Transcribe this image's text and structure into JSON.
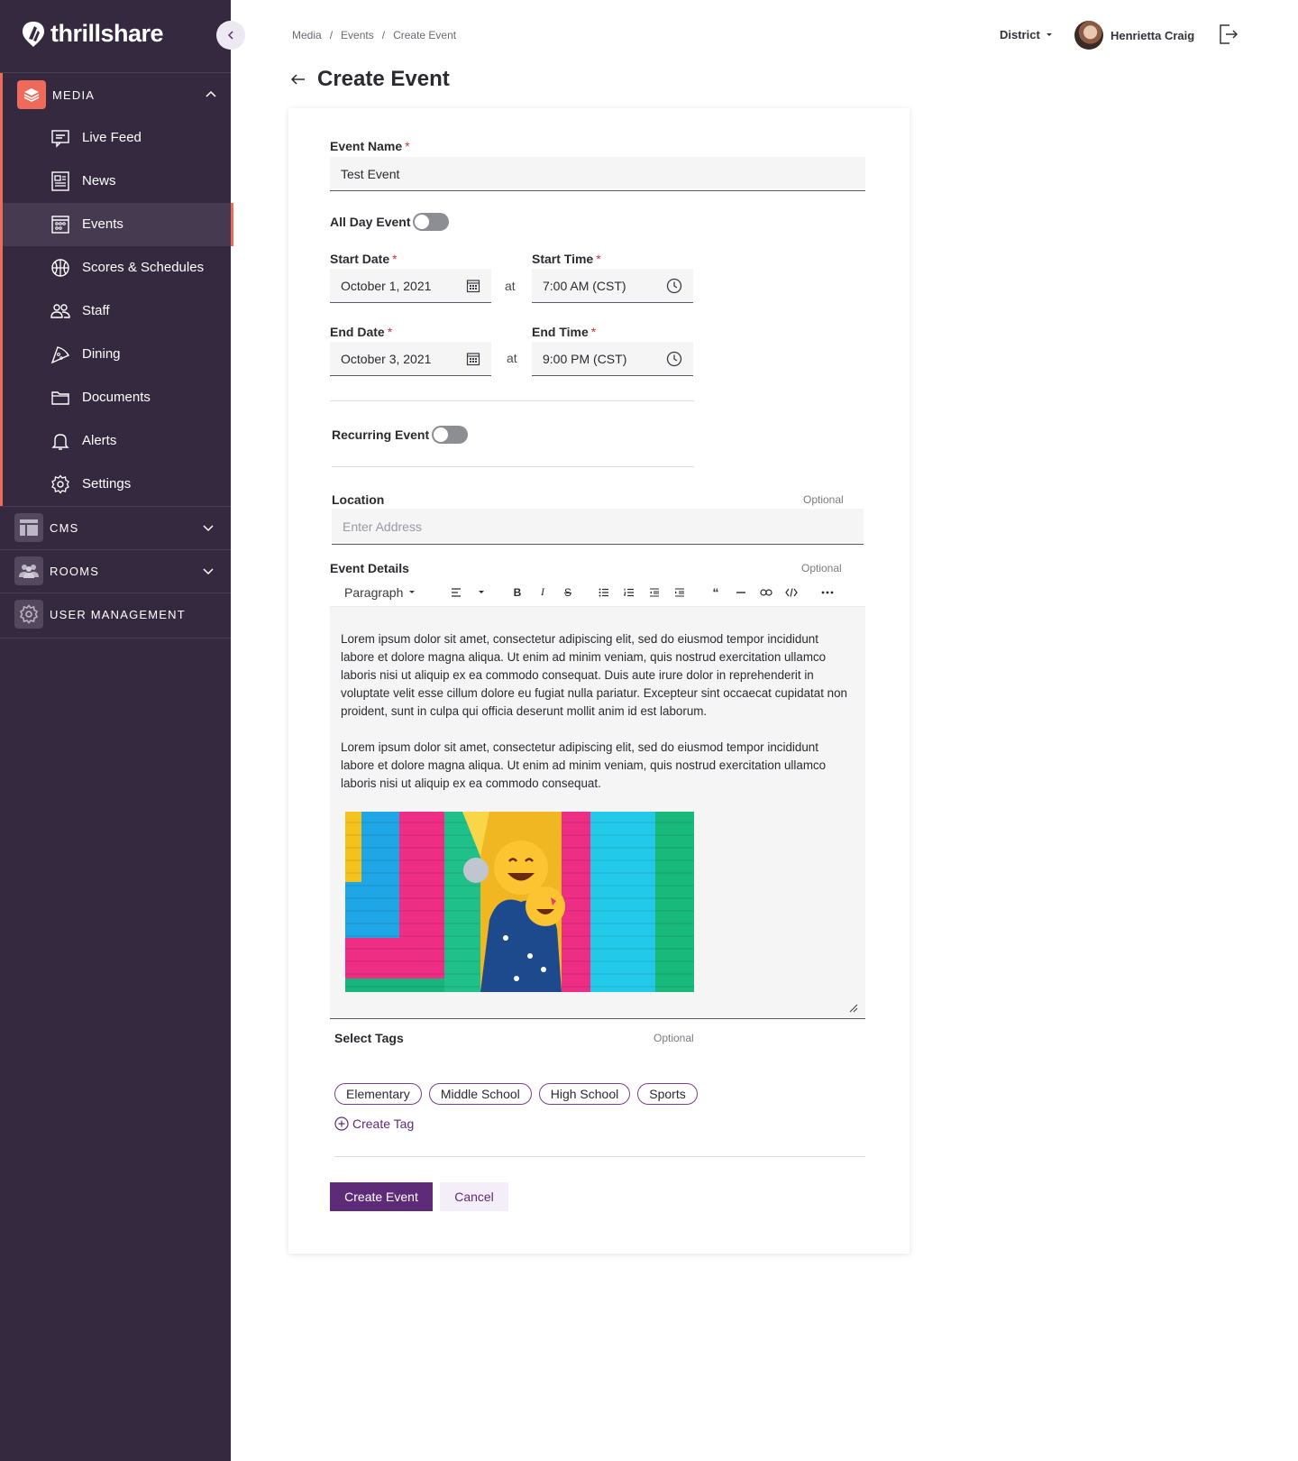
{
  "brand": {
    "name": "thrillshare"
  },
  "sidebar": {
    "sections": [
      {
        "label": "MEDIA",
        "icon": "layers-icon",
        "expanded": true,
        "color": "#f06a5a"
      },
      {
        "label": "CMS",
        "icon": "layout-icon",
        "expanded": false
      },
      {
        "label": "ROOMS",
        "icon": "group-icon",
        "expanded": false
      },
      {
        "label": "USER MANAGEMENT",
        "icon": "gear-icon",
        "expanded": false
      }
    ],
    "media_items": [
      {
        "label": "Live Feed",
        "icon": "chat-icon"
      },
      {
        "label": "News",
        "icon": "newspaper-icon"
      },
      {
        "label": "Events",
        "icon": "calendar-icon",
        "active": true
      },
      {
        "label": "Scores & Schedules",
        "icon": "ball-icon"
      },
      {
        "label": "Staff",
        "icon": "people-icon"
      },
      {
        "label": "Dining",
        "icon": "pizza-icon"
      },
      {
        "label": "Documents",
        "icon": "folder-icon"
      },
      {
        "label": "Alerts",
        "icon": "bell-icon"
      },
      {
        "label": "Settings",
        "icon": "gear-icon"
      }
    ]
  },
  "breadcrumb": [
    "Media",
    "Events",
    "Create Event"
  ],
  "topbar": {
    "district": "District",
    "user_name": "Henrietta Craig"
  },
  "page": {
    "title": "Create Event"
  },
  "form": {
    "event_name": {
      "label": "Event Name",
      "value": "Test Event"
    },
    "all_day": {
      "label": "All Day Event",
      "on": false
    },
    "start_date": {
      "label": "Start Date",
      "value": "October 1, 2021"
    },
    "start_time": {
      "label": "Start Time",
      "value": "7:00 AM (CST)"
    },
    "end_date": {
      "label": "End Date",
      "value": "October 3, 2021"
    },
    "end_time": {
      "label": "End Time",
      "value": "9:00 PM (CST)"
    },
    "at_label": "at",
    "recurring": {
      "label": "Recurring Event",
      "on": false
    },
    "location": {
      "label": "Location",
      "placeholder": "Enter Address",
      "optional": "Optional"
    },
    "details": {
      "label": "Event Details",
      "optional": "Optional",
      "block_style": "Paragraph",
      "paragraphs": [
        "Lorem ipsum dolor sit amet, consectetur adipiscing elit, sed do eiusmod tempor incididunt labore et dolore magna aliqua. Ut enim ad minim veniam, quis nostrud exercitation ullamco laboris nisi ut aliquip ex ea commodo consequat. Duis aute irure dolor in reprehenderit in voluptate velit esse cillum dolore eu fugiat nulla pariatur. Excepteur sint occaecat cupidatat non proident, sunt in culpa qui officia deserunt mollit anim id est laborum.",
        "Lorem ipsum dolor sit amet, consectetur adipiscing elit, sed do eiusmod tempor incididunt labore et dolore magna aliqua. Ut enim ad minim veniam, quis nostrud exercitation ullamco laboris nisi ut aliquip ex ea commodo consequat."
      ]
    },
    "tags": {
      "label": "Select Tags",
      "optional": "Optional",
      "items": [
        "Elementary",
        "Middle School",
        "High School",
        "Sports"
      ],
      "create_label": "Create Tag"
    },
    "submit_label": "Create Event",
    "cancel_label": "Cancel"
  },
  "colors": {
    "sidebar": "#35293f",
    "accent": "#f06a5a",
    "primary": "#5e2b78"
  }
}
